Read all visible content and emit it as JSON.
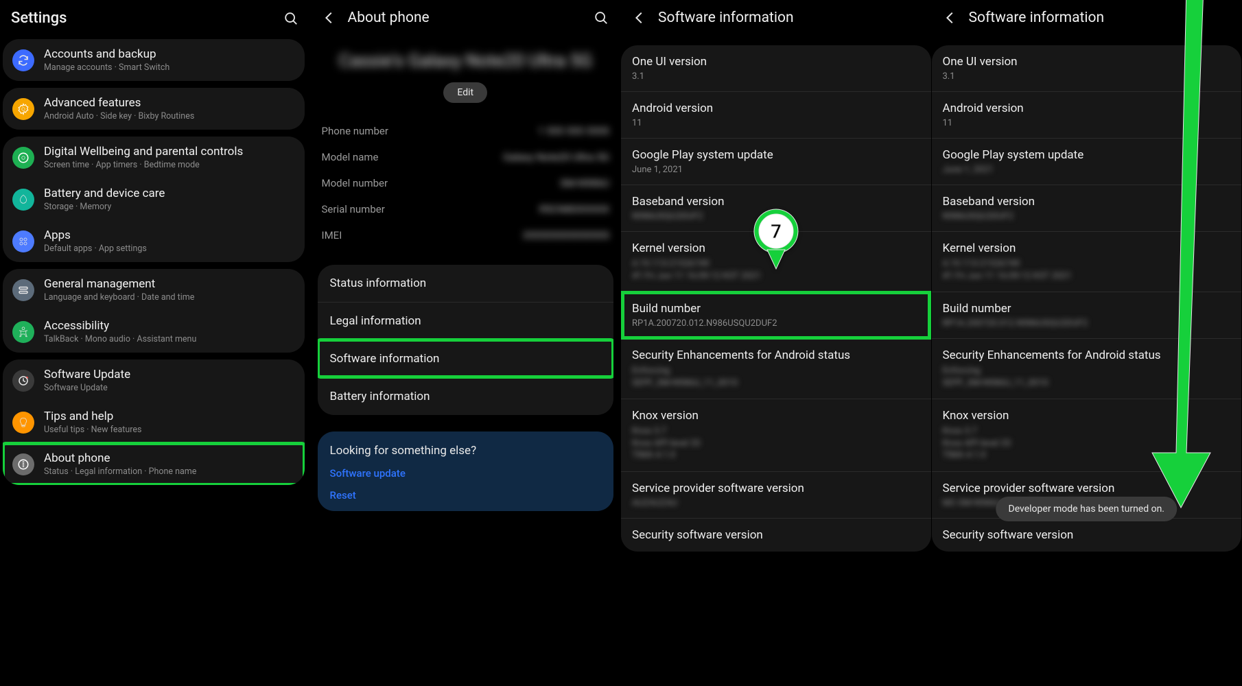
{
  "panel1": {
    "title": "Settings",
    "groups": [
      [
        {
          "icon": "sync",
          "bg": "#3d6bff",
          "title": "Accounts and backup",
          "sub": "Manage accounts  ·  Smart Switch"
        }
      ],
      [
        {
          "icon": "gear-adv",
          "bg": "#f7a600",
          "title": "Advanced features",
          "sub": "Android Auto  ·  Side key  ·  Bixby Routines"
        }
      ],
      [
        {
          "icon": "wellbeing",
          "bg": "#1eb053",
          "title": "Digital Wellbeing and parental controls",
          "sub": "Screen time  ·  App timers  ·  Bedtime mode"
        },
        {
          "icon": "battery",
          "bg": "#12b59b",
          "title": "Battery and device care",
          "sub": "Storage  ·  Memory"
        },
        {
          "icon": "apps",
          "bg": "#4d7bff",
          "title": "Apps",
          "sub": "Default apps  ·  App settings"
        }
      ],
      [
        {
          "icon": "general",
          "bg": "#5c6b7a",
          "title": "General management",
          "sub": "Language and keyboard  ·  Date and time"
        },
        {
          "icon": "accessibility",
          "bg": "#1fb05a",
          "title": "Accessibility",
          "sub": "TalkBack  ·  Mono audio  ·  Assistant menu"
        }
      ],
      [
        {
          "icon": "update",
          "bg": "#3a3a3a",
          "title": "Software Update",
          "sub": "Software Update"
        },
        {
          "icon": "tips",
          "bg": "#ff9500",
          "title": "Tips and help",
          "sub": "Useful tips  ·  New features"
        },
        {
          "icon": "about",
          "bg": "#6c6c6c",
          "title": "About phone",
          "sub": "Status  ·  Legal information  ·  Phone name",
          "highlight": true
        }
      ]
    ]
  },
  "panel2": {
    "title": "About phone",
    "deviceName": "Cassie's Galaxy Note20 Ultra 5G",
    "editLabel": "Edit",
    "kv": [
      {
        "label": "Phone number",
        "val": "1 555 555 5555"
      },
      {
        "label": "Model name",
        "val": "Galaxy Note20 Ultra 5G"
      },
      {
        "label": "Model number",
        "val": "SM-N986U"
      },
      {
        "label": "Serial number",
        "val": "R5CN80XXXXX"
      },
      {
        "label": "IMEI",
        "val": "355555555555555"
      }
    ],
    "infoItems": [
      "Status information",
      "Legal information",
      "Software information",
      "Battery information"
    ],
    "lfseTitle": "Looking for something else?",
    "lfseLinks": [
      "Software update",
      "Reset"
    ]
  },
  "panel3": {
    "title": "Software information",
    "items": [
      {
        "title": "One UI version",
        "val": "3.1"
      },
      {
        "title": "Android version",
        "val": "11"
      },
      {
        "title": "Google Play system update",
        "val": "June 1, 2021"
      },
      {
        "title": "Baseband version",
        "val": "N986USQU2DUF2",
        "blur": true
      },
      {
        "title": "Kernel version",
        "val": "4.19.113-21526749\n#1 Fri Jun 11 16:09:12 KST 2021",
        "blur": true,
        "multi": true
      },
      {
        "title": "Build number",
        "val": "RP1A.200720.012.N986USQU2DUF2",
        "highlight": true
      },
      {
        "title": "Security Enhancements for Android status",
        "val": "Enforcing\nSEPF_SM-N986U_11_0010",
        "blur": true,
        "multi": true
      },
      {
        "title": "Knox version",
        "val": "Knox 3.7\nKnox API level 33\nTIMA 4.1.0",
        "blur": true,
        "multi": true
      },
      {
        "title": "Service provider software version",
        "val": "AUZAUZAU",
        "blur": true
      },
      {
        "title": "Security software version",
        "val": ""
      }
    ],
    "badge": "7"
  },
  "panel4": {
    "title": "Software information",
    "toast": "Developer mode has been turned on.",
    "items": [
      {
        "title": "One UI version",
        "val": "3.1"
      },
      {
        "title": "Android version",
        "val": "11"
      },
      {
        "title": "Google Play system update",
        "val": "June 1, 2021",
        "blur": true
      },
      {
        "title": "Baseband version",
        "val": "N986USQU2DUF2",
        "blur": true
      },
      {
        "title": "Kernel version",
        "val": "4.19.113-21526749\n#1 Fri Jun 11 16:09:12 KST 2021",
        "blur": true,
        "multi": true
      },
      {
        "title": "Build number",
        "val": "RP1A.200720.012.N986USQU2DUF2",
        "blur": true
      },
      {
        "title": "Security Enhancements for Android status",
        "val": "Enforcing\nSEPF_SM-N986U_11_0010",
        "blur": true,
        "multi": true
      },
      {
        "title": "Knox version",
        "val": "Knox 3.7\nKnox API level 33\nTIMA 4.1.0",
        "blur": true,
        "multi": true
      },
      {
        "title": "Service provider software version",
        "val": "MC-SM-N986U_OYN_PP1_NN_0009",
        "blur": true
      },
      {
        "title": "Security software version",
        "val": ""
      }
    ]
  }
}
